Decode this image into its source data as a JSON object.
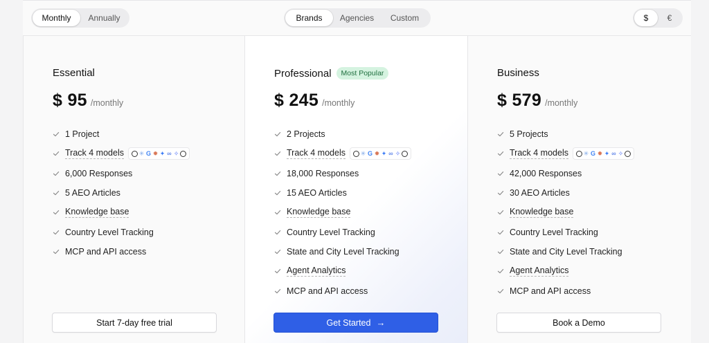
{
  "billing_toggle": {
    "options": [
      "Monthly",
      "Annually"
    ],
    "selected": "Monthly"
  },
  "audience_toggle": {
    "options": [
      "Brands",
      "Agencies",
      "Custom"
    ],
    "selected": "Brands"
  },
  "currency_toggle": {
    "options": [
      "$",
      "€"
    ],
    "selected": "$"
  },
  "colors": {
    "accent": "#2f5fe6",
    "badge_bg": "#d5f3e0",
    "badge_text": "#1f6e3e"
  },
  "plans": [
    {
      "name": "Essential",
      "badge": "",
      "currency": "$",
      "amount": "95",
      "period": "/monthly",
      "features": [
        "1 Project",
        "Track 4 models",
        "6,000 Responses",
        "5 AEO Articles",
        "Knowledge base",
        "Country Level Tracking",
        "MCP and API access"
      ],
      "cta": "Start 7-day free trial"
    },
    {
      "name": "Professional",
      "badge": "Most Popular",
      "currency": "$",
      "amount": "245",
      "period": "/monthly",
      "features": [
        "2 Projects",
        "Track 4 models",
        "18,000 Responses",
        "15 AEO Articles",
        "Knowledge base",
        "Country Level Tracking",
        "State and City Level Tracking",
        "Agent Analytics",
        "MCP and API access"
      ],
      "cta": "Get Started"
    },
    {
      "name": "Business",
      "badge": "",
      "currency": "$",
      "amount": "579",
      "period": "/monthly",
      "features": [
        "5 Projects",
        "Track 4 models",
        "42,000 Responses",
        "30 AEO Articles",
        "Knowledge base",
        "Country Level Tracking",
        "State and City Level Tracking",
        "Agent Analytics",
        "MCP and API access"
      ],
      "cta": "Book a Demo"
    }
  ],
  "model_icons": [
    "openai-icon",
    "perplexity-icon",
    "google-icon",
    "claude-icon",
    "gemini-icon",
    "meta-icon",
    "copilot-icon",
    "grok-icon"
  ]
}
